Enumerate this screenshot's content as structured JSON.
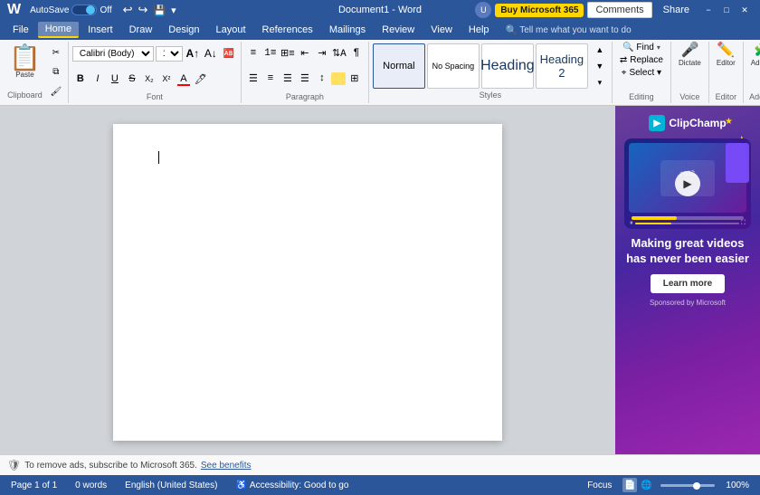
{
  "titleBar": {
    "autosave_label": "AutoSave",
    "autosave_state": "Off",
    "filename": "Document1 - Word",
    "undo_tip": "Undo",
    "redo_tip": "Redo",
    "buy_label": "Buy Microsoft 365",
    "comments_label": "Comments",
    "share_label": "Share",
    "minimize": "−",
    "restore": "□",
    "close": "✕"
  },
  "menuBar": {
    "items": [
      "File",
      "Home",
      "Insert",
      "Draw",
      "Design",
      "Layout",
      "References",
      "Mailings",
      "Review",
      "View",
      "Help"
    ]
  },
  "toolbar": {
    "sections": {
      "clipboard": {
        "label": "Clipboard",
        "paste_label": "Paste"
      },
      "font": {
        "label": "Font",
        "font_name": "Calibri (Body)",
        "font_size": "11",
        "bold": "B",
        "italic": "I",
        "underline": "U",
        "strikethrough": "S",
        "subscript": "X₂",
        "superscript": "X²",
        "font_color": "A",
        "highlight": "🖊"
      },
      "paragraph": {
        "label": "Paragraph"
      },
      "styles": {
        "label": "Styles",
        "items": [
          {
            "name": "Normal",
            "style": "normal"
          },
          {
            "name": "No Spacing",
            "style": "no-spacing"
          },
          {
            "name": "Heading",
            "style": "heading1"
          },
          {
            "name": "Heading 2",
            "style": "heading2"
          }
        ]
      },
      "editing": {
        "label": "Editing",
        "find": "Find",
        "replace": "Replace",
        "select": "Select ▾"
      },
      "voice": {
        "label": "Voice",
        "dictate": "Dictate"
      },
      "editor_label": {
        "label": "Editor",
        "text": "Editor"
      },
      "addins": {
        "label": "Add-ins",
        "text": "Add-ins"
      }
    }
  },
  "document": {
    "page": "Page 1 of 1",
    "words": "0 words",
    "language": "English (United States)",
    "accessibility": "Accessibility: Good to go",
    "zoom": "100%",
    "cursor_visible": true
  },
  "ad": {
    "brand": "ClipChamp",
    "headline": "Making great videos has never been easier",
    "cta": "Learn more",
    "sponsored": "Sponsored by Microsoft",
    "notice": "To remove ads, subscribe to Microsoft 365.",
    "see_benefits": "See benefits"
  },
  "statusBar": {
    "page": "Page 1 of 1",
    "words": "0 words",
    "language": "English (United States)",
    "accessibility": "Accessibility: Good to go",
    "focus": "Focus",
    "zoom": "100%"
  }
}
